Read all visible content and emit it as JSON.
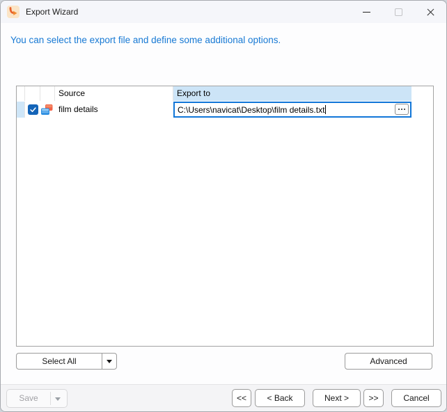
{
  "window": {
    "title": "Export Wizard"
  },
  "instruction": "You can select the export file and define some additional options.",
  "table": {
    "headers": {
      "source": "Source",
      "export_to": "Export to"
    },
    "rows": [
      {
        "checked": true,
        "source": "film details",
        "export_to": "C:\\Users\\navicat\\Desktop\\film details.txt"
      }
    ]
  },
  "actions": {
    "select_all": "Select All",
    "advanced": "Advanced"
  },
  "footer": {
    "save": "Save",
    "first": "<<",
    "back": "< Back",
    "next": "Next >",
    "last": ">>",
    "cancel": "Cancel"
  },
  "colors": {
    "accent_blue": "#1176d8",
    "instruction_text": "#1779d4",
    "header_highlight": "#cce4f7",
    "row_indicator": "#cfe6f8",
    "checkbox_blue": "#1464b8",
    "icon_orange": "#f0644a",
    "icon_blue": "#2e8fe0",
    "app_icon_bg": "#fbe4c6",
    "app_icon_arrow": "#ee7d23"
  }
}
